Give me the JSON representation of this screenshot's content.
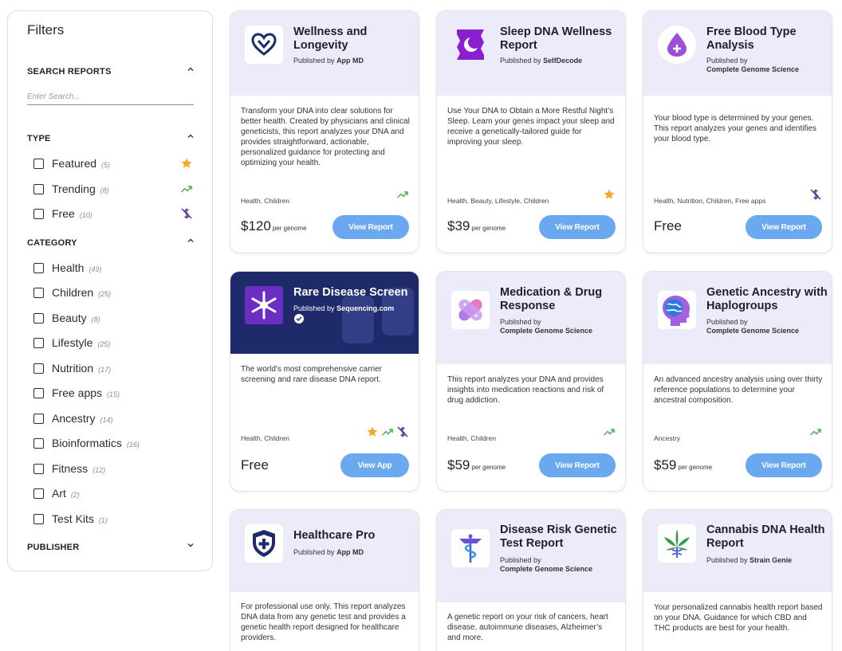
{
  "sidebar": {
    "title": "Filters",
    "search_section": "SEARCH REPORTS",
    "search_placeholder": "Enter Search...",
    "type_section": "TYPE",
    "type_items": [
      {
        "label": "Featured",
        "count": "(5)"
      },
      {
        "label": "Trending",
        "count": "(8)"
      },
      {
        "label": "Free",
        "count": "(10)"
      }
    ],
    "category_section": "CATEGORY",
    "category_items": [
      {
        "label": "Health",
        "count": "(49)"
      },
      {
        "label": "Children",
        "count": "(25)"
      },
      {
        "label": "Beauty",
        "count": "(8)"
      },
      {
        "label": "Lifestyle",
        "count": "(25)"
      },
      {
        "label": "Nutrition",
        "count": "(17)"
      },
      {
        "label": "Free apps",
        "count": "(15)"
      },
      {
        "label": "Ancestry",
        "count": "(14)"
      },
      {
        "label": "Bioinformatics",
        "count": "(16)"
      },
      {
        "label": "Fitness",
        "count": "(12)"
      },
      {
        "label": "Art",
        "count": "(2)"
      },
      {
        "label": "Test Kits",
        "count": "(1)"
      }
    ],
    "publisher_section": "PUBLISHER"
  },
  "colors": {
    "accent": "#6aa8f0",
    "card_header": "#ebebfa",
    "featured_star": "#f5a623",
    "trending": "#4caf50",
    "free_icon": "#5b2a86"
  },
  "published_by_label": "Published by",
  "cards": [
    {
      "title": "Wellness and Longevity",
      "publisher": "App MD",
      "description": "Transform your DNA into clear solutions for better health. Created by physicians and clinical geneticists, this report analyzes your DNA and provides straightforward, actionable, personalized guidance for protecting and optimizing your health.",
      "tags": "Health, Children",
      "price": "$120",
      "price_unit": "per genome",
      "button": "View Report",
      "icons": [
        "trending-icon"
      ]
    },
    {
      "title": "Sleep DNA Wellness Report",
      "publisher": "SelfDecode",
      "description": "Use Your DNA to Obtain a More Restful Night’s Sleep. Learn your genes impact your sleep and receive a genetically-tailored guide for improving your sleep.",
      "tags": "Health, Beauty, Lifestyle, Children",
      "price": "$39",
      "price_unit": "per genome",
      "button": "View Report",
      "icons": [
        "featured-star-icon"
      ]
    },
    {
      "title": "Free Blood Type Analysis",
      "publisher": "Complete Genome Science",
      "description": "Your blood type is determined by your genes. This report analyzes your genes and identifies your blood type.",
      "tags": "Health, Nutrition, Children, Free apps",
      "price": "Free",
      "price_unit": "",
      "button": "View Report",
      "icons": [
        "free-icon"
      ]
    },
    {
      "title": "Rare Disease Screen",
      "publisher": "Sequencing.com",
      "description": "The world's most comprehensive carrier screening and rare disease DNA report.",
      "tags": "Health, Children",
      "price": "Free",
      "price_unit": "",
      "button": "View App",
      "icons": [
        "featured-star-icon",
        "trending-icon",
        "free-icon"
      ]
    },
    {
      "title": "Medication & Drug Response",
      "publisher": "Complete Genome Science",
      "description": "This report analyzes your DNA and provides insights into medication reactions and risk of drug addiction.",
      "tags": "Health, Children",
      "price": "$59",
      "price_unit": "per genome",
      "button": "View Report",
      "icons": [
        "trending-icon"
      ]
    },
    {
      "title": "Genetic Ancestry with Haplogroups",
      "publisher": "Complete Genome Science",
      "description": "An advanced ancestry analysis using over thirty reference populations to determine your ancestral composition.",
      "tags": "Ancestry",
      "price": "$59",
      "price_unit": "per genome",
      "button": "View Report",
      "icons": [
        "trending-icon"
      ]
    },
    {
      "title": "Healthcare Pro",
      "publisher": "App MD",
      "description": "For professional use only. This report analyzes DNA data from any genetic test and provides a genetic health report designed for healthcare providers."
    },
    {
      "title": "Disease Risk Genetic Test Report",
      "publisher": "Complete Genome Science",
      "description": "A genetic report on your risk of cancers, heart disease, autoimmune diseases, Alzheimer’s and more."
    },
    {
      "title": "Cannabis DNA Health Report",
      "publisher": "Strain Genie",
      "description": "Your personalized cannabis health report based on your DNA. Guidance for which CBD and THC products are best for your health."
    }
  ]
}
